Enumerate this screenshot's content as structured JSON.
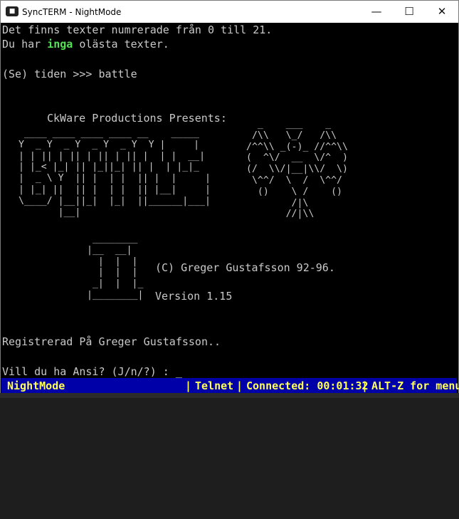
{
  "window": {
    "title": "SyncTERM - NightMode",
    "icon": "syncterm-app-icon",
    "minimize_glyph": "—",
    "maximize_glyph": "☐",
    "close_glyph": "✕"
  },
  "terminal": {
    "line1": "Det finns texter numrerade från 0 till 21.",
    "line2_prefix": "Du har ",
    "line2_highlight": "inga",
    "line2_suffix": " olästa texter.",
    "prompt": "(Se) tiden >>> battle",
    "presents": "CkWare Productions Presents:",
    "logo_art": " ____ ____ ____ ____ __    _____\nY  _ Y  _ Y  _ Y  _ Y  Y |     |\n| | || | || | || | || |  | |  __|\n| |_< |_| || |_||_| || |  | |_|_\n|  _ \\ Y  || |  | |  || |  |     |\n| |_| ||  || |  | |  || |__|     |\n\\____/ |__||_|  |_|  ||______|___|\n       |__|",
    "numeral_art": " ________\n|__  __|\n  |  |  |\n  |  |  |\n _|  |  |_\n|________|",
    "creature_art": "  _    ___    _\n /\\\\   \\_/   /\\\\\n/^^\\\\ _(-)_ //^^\\\\\n(  ^\\/  __  \\/^  )\n(/  \\\\/|__|\\\\/  \\)\n \\^^/  \\  /  \\^^/\n  ()    \\ /    ()\n        /|\\\n       //|\\\\",
    "copyright": "(C) Greger Gustafsson 92-96.",
    "version": "Version 1.15",
    "registered": "Registrerad På Greger Gustafsson..",
    "ansi_prompt": "Vill du ha Ansi? (J/n/?) : ",
    "cursor": "_"
  },
  "statusbar": {
    "name": "NightMode",
    "protocol": "Telnet",
    "connected": "Connected: 00:01:32",
    "help": "ALT-Z for menu"
  },
  "colors": {
    "terminal_bg": "#000000",
    "terminal_text": "#c9c9c9",
    "highlight_green": "#55e055",
    "status_bg": "#0000a8",
    "status_text": "#ffff55"
  }
}
